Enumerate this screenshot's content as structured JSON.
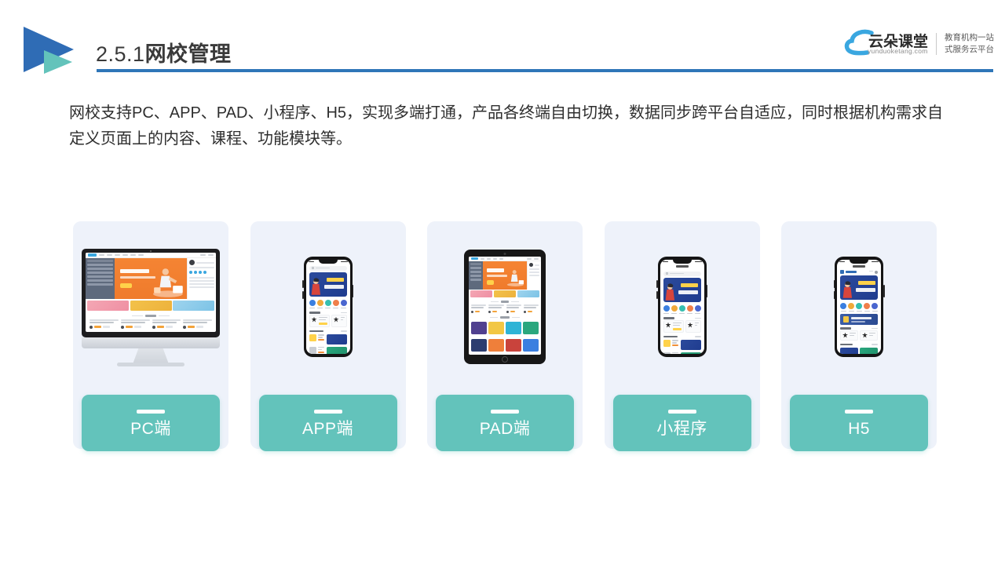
{
  "header": {
    "section_number": "2.5.1",
    "title_cn": "网校管理",
    "arrow_logo_icon": "double-triangle-play-icon",
    "rule_color": "#2f76b8"
  },
  "brand": {
    "cloud_icon": "cloud-icon",
    "name_cn": "云朵课堂",
    "url": "yunduoketang.com",
    "tagline_line1": "教育机构一站",
    "tagline_line2": "式服务云平台",
    "accent_color": "#3aa7e0"
  },
  "body": {
    "paragraph": "网校支持PC、APP、PAD、小程序、H5，实现多端打通，产品各终端自由切换，数据同步跨平台自适应，同时根据机构需求自定义页面上的内容、课程、功能模块等。"
  },
  "theme": {
    "card_bg": "#eef2fa",
    "label_teal": "#63c3bb",
    "title_blue": "#2f76b8",
    "logo_dark_blue": "#2f6cb5",
    "logo_teal": "#63c3bb",
    "hero_orange": "#f58433",
    "banner_blue": "#2b4a9c"
  },
  "cards": [
    {
      "id": "pc",
      "label": "PC端",
      "device": "desktop-monitor-icon"
    },
    {
      "id": "app",
      "label": "APP端",
      "device": "smartphone-icon"
    },
    {
      "id": "pad",
      "label": "PAD端",
      "device": "tablet-icon"
    },
    {
      "id": "mini",
      "label": "小程序",
      "device": "smartphone-icon"
    },
    {
      "id": "h5",
      "label": "H5",
      "device": "smartphone-icon"
    }
  ]
}
